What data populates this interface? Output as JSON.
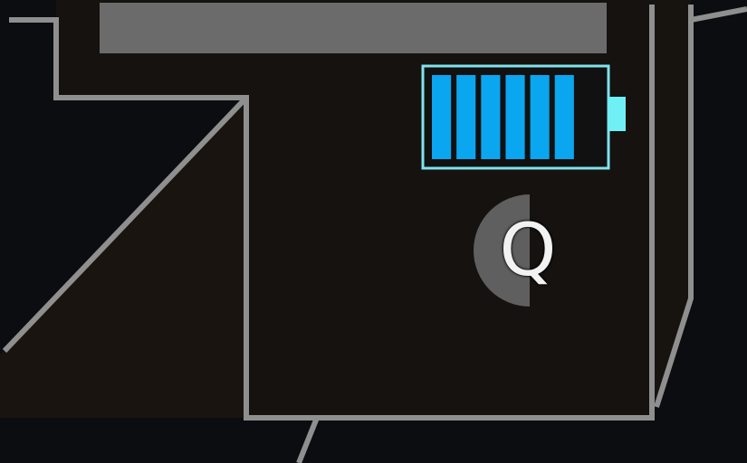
{
  "hud": {
    "battery": {
      "charge_fraction": 0.78,
      "segments_total": 7,
      "segments_filled": 6,
      "color_fill": "#0aa6ef",
      "color_frame": "#7fe3ec",
      "color_cap": "#6ff0f5",
      "icon": "battery-icon"
    },
    "ability_prompt": {
      "key": "Q",
      "cooldown_fraction": 0.5,
      "cooldown_color": "#5f5f5f",
      "icon": "cooldown-ring-icon"
    }
  },
  "colors": {
    "background": "#0b0d10",
    "room_floor": "#15120f",
    "wall": "#8f8f8f",
    "door": "#6b6b6b"
  }
}
